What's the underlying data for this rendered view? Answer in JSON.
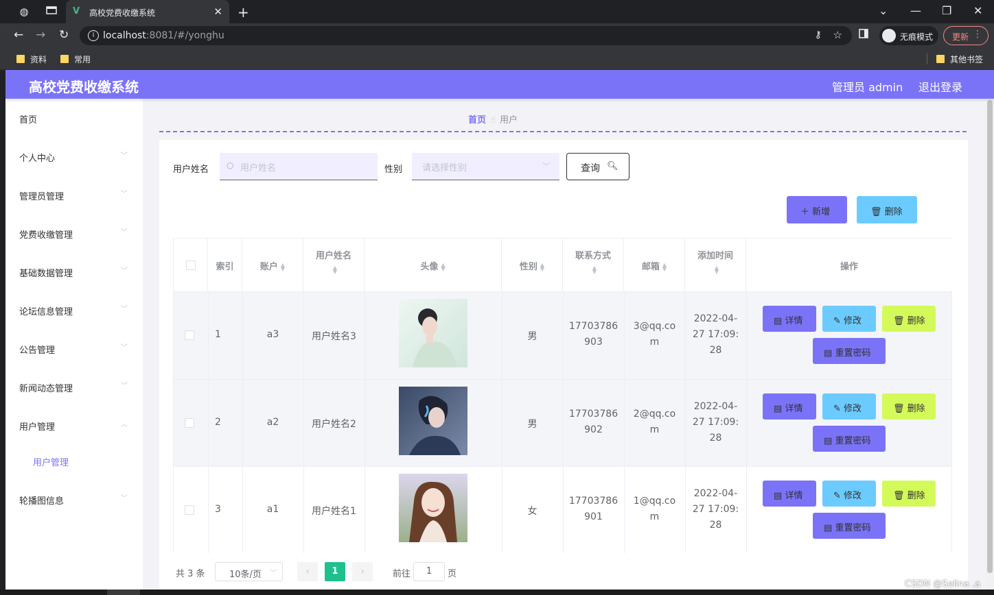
{
  "browser": {
    "tab_title": "高校党费收缴系统",
    "url_host": "localhost",
    "url_rest": ":8081/#/yonghu",
    "incognito_label": "无痕模式",
    "update_label": "更新",
    "bookmarks": [
      "资料",
      "常用"
    ],
    "other_bookmarks": "其他书签"
  },
  "header": {
    "brand": "高校党费收缴系统",
    "admin": "管理员 admin",
    "logout": "退出登录"
  },
  "sidebar": {
    "items": [
      {
        "label": "首页",
        "chevron": ""
      },
      {
        "label": "个人中心",
        "chevron": "⌄"
      },
      {
        "label": "管理员管理",
        "chevron": "⌄"
      },
      {
        "label": "党费收缴管理",
        "chevron": "⌄"
      },
      {
        "label": "基础数据管理",
        "chevron": "⌄"
      },
      {
        "label": "论坛信息管理",
        "chevron": "⌄"
      },
      {
        "label": "公告管理",
        "chevron": "⌄"
      },
      {
        "label": "新闻动态管理",
        "chevron": "⌄"
      },
      {
        "label": "用户管理",
        "chevron": "⌃"
      },
      {
        "label": "轮播图信息",
        "chevron": "⌄"
      }
    ],
    "sub_item": "用户管理"
  },
  "breadcrumb": {
    "home": "首页",
    "current": "用户"
  },
  "filters": {
    "name_label": "用户姓名",
    "name_placeholder": "用户姓名",
    "gender_label": "性别",
    "gender_placeholder": "请选择性别",
    "query_label": "查询"
  },
  "actions": {
    "add_label": "新增",
    "delete_label": "删除"
  },
  "table": {
    "headers": [
      "索引",
      "账户",
      "用户姓名",
      "头像",
      "性别",
      "联系方式",
      "邮箱",
      "添加时间",
      "操作"
    ],
    "rows": [
      {
        "index": "1",
        "account": "a3",
        "name": "用户姓名3",
        "gender": "男",
        "phone1": "17703786",
        "phone2": "903",
        "email1": "3@qq.co",
        "email2": "m",
        "time1": "2022-04-",
        "time2": "27 17:09:",
        "time3": "28"
      },
      {
        "index": "2",
        "account": "a2",
        "name": "用户姓名2",
        "gender": "男",
        "phone1": "17703786",
        "phone2": "902",
        "email1": "2@qq.co",
        "email2": "m",
        "time1": "2022-04-",
        "time2": "27 17:09:",
        "time3": "28"
      },
      {
        "index": "3",
        "account": "a1",
        "name": "用户姓名1",
        "gender": "女",
        "phone1": "17703786",
        "phone2": "901",
        "email1": "1@qq.co",
        "email2": "m",
        "time1": "2022-04-",
        "time2": "27 17:09:",
        "time3": "28"
      }
    ],
    "op_labels": {
      "detail": "详情",
      "edit": "修改",
      "delete": "删除",
      "reset": "重置密码"
    }
  },
  "pagination": {
    "total": "共 3 条",
    "page_size": "10条/页",
    "current_page": "1",
    "goto_label": "前往",
    "goto_value": "1",
    "page_unit": "页"
  },
  "watermark": "CSDN @Selina .a",
  "colors": {
    "accent": "#7b73f7",
    "cyan": "#6ccbfe",
    "lime": "#d4fa5a",
    "page_active": "#1fc08e"
  }
}
